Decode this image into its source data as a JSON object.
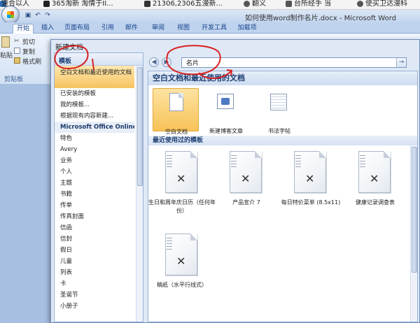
{
  "bookmarks": [
    {
      "label": "速合以人",
      "color": "#2f6db4"
    },
    {
      "label": "365淘新  淘情于II...",
      "color": "#222222"
    },
    {
      "label": "21306,2306五漫新...",
      "color": "#222222"
    },
    {
      "label": "翻义",
      "color": "#444444"
    },
    {
      "label": "台所经手 当",
      "color": "#444444"
    },
    {
      "label": "使买卫达漫科",
      "color": "#444444"
    }
  ],
  "window": {
    "title": "如何使用word制作名片.docx - Microsoft Word"
  },
  "ribbon_tabs": [
    "开始",
    "插入",
    "页面布局",
    "引用",
    "邮件",
    "审阅",
    "视图",
    "开发工具",
    "加载项"
  ],
  "clipboard": {
    "cut": "剪切",
    "copy": "复制",
    "format_painter": "格式刷",
    "paste": "粘贴",
    "group_label": "剪贴板"
  },
  "dialog": {
    "title": "新建文档"
  },
  "left_pane": {
    "header": "模板",
    "items": [
      {
        "label": "空白文档和最近使用的文档",
        "type": "selected"
      },
      {
        "label": "已安装的模板",
        "type": "item"
      },
      {
        "label": "我的模板...",
        "type": "item"
      },
      {
        "label": "根据现有内容新建...",
        "type": "item"
      },
      {
        "label": "Microsoft Office Online",
        "type": "section"
      },
      {
        "label": "特色",
        "type": "item"
      },
      {
        "label": "Avery",
        "type": "item"
      },
      {
        "label": "业务",
        "type": "item"
      },
      {
        "label": "个人",
        "type": "item"
      },
      {
        "label": "主题",
        "type": "item"
      },
      {
        "label": "书籍",
        "type": "item"
      },
      {
        "label": "传单",
        "type": "item"
      },
      {
        "label": "传真封面",
        "type": "item"
      },
      {
        "label": "信函",
        "type": "item"
      },
      {
        "label": "信封",
        "type": "item"
      },
      {
        "label": "假日",
        "type": "item"
      },
      {
        "label": "儿童",
        "type": "item"
      },
      {
        "label": "列表",
        "type": "item"
      },
      {
        "label": "卡",
        "type": "item"
      },
      {
        "label": "圣诞节",
        "type": "item"
      },
      {
        "label": "小册子",
        "type": "item"
      }
    ]
  },
  "search": {
    "value": "名片",
    "go": "→"
  },
  "nav": {
    "back": "◀",
    "forward": "▶"
  },
  "section1": {
    "title": "空白文档和最近使用的文档",
    "tiles": [
      {
        "label": "空白文档",
        "icon": "blank-doc-icon",
        "selected": true
      },
      {
        "label": "新建博客文章",
        "icon": "blog-post-icon",
        "selected": false
      },
      {
        "label": "书法字帖",
        "icon": "calligraphy-icon",
        "selected": false
      }
    ]
  },
  "section2": {
    "title": "最近使用过的模板",
    "templates": [
      {
        "label": "生日和周年庆日历（任何年份）"
      },
      {
        "label": "产品宣介 7"
      },
      {
        "label": "每日特价菜单 (8.5x11)"
      },
      {
        "label": "健康记录调查表"
      },
      {
        "label": "稿纸（水平行线式）"
      }
    ]
  },
  "annotation_color": "#d92020"
}
